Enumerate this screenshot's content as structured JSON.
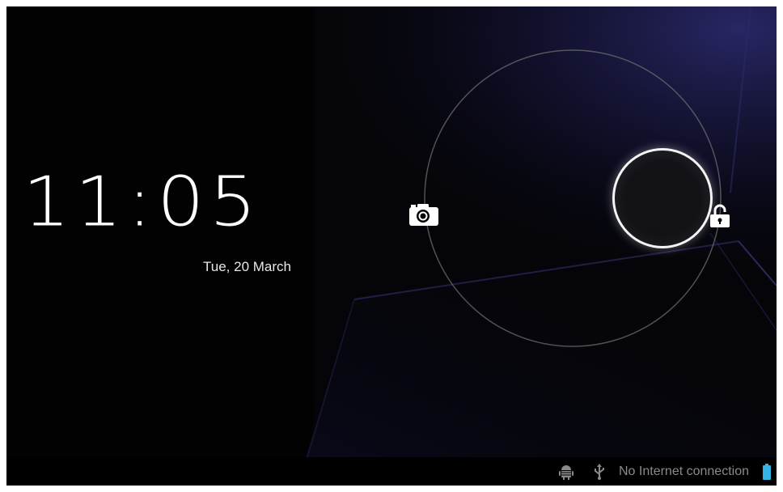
{
  "lockscreen": {
    "time": "11:05",
    "date": "Tue, 20 March"
  },
  "targets": {
    "left_icon": "camera-icon",
    "right_icon": "unlock-icon",
    "handle_icon": "unlock-handle"
  },
  "statusbar": {
    "icons": [
      "android-debug-icon",
      "usb-icon",
      "battery-icon"
    ],
    "network_text": "No Internet connection"
  },
  "colors": {
    "background": "#020203",
    "accent_wallpaper": "#2a2a6a",
    "battery": "#33b5e5",
    "text": "#ffffff",
    "status_text": "#8a8a8a"
  }
}
